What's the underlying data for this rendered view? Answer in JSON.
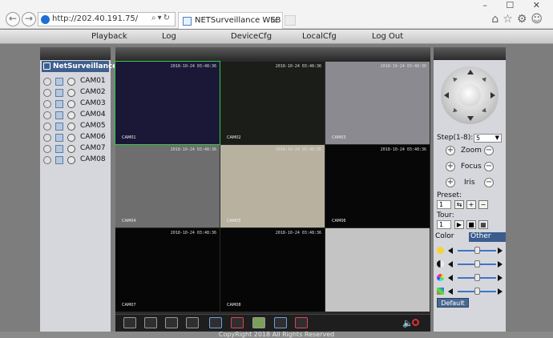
{
  "browser": {
    "url": "http://202.40.191.75/",
    "tab_title": "NETSurveillance WEB"
  },
  "menu": [
    "Playback",
    "Log",
    "DeviceCfg",
    "LocalCfg",
    "Log Out"
  ],
  "tree": {
    "title": "NetSurveillance",
    "cameras": [
      "CAM01",
      "CAM02",
      "CAM03",
      "CAM04",
      "CAM05",
      "CAM06",
      "CAM07",
      "CAM08"
    ]
  },
  "video": {
    "cells": [
      {
        "ts": "2018-10-24 03:48:36",
        "name": "CAM01",
        "bg": "#1a1836"
      },
      {
        "ts": "2018-10-24 03:48:36",
        "name": "CAM02",
        "bg": "#1b1d19"
      },
      {
        "ts": "2018-10-24 03:48:36",
        "name": "CAM03",
        "bg": "#8a8a90"
      },
      {
        "ts": "2018-10-24 03:48:36",
        "name": "CAM04",
        "bg": "#6e6e6e"
      },
      {
        "ts": "2018-10-24 03:48:36",
        "name": "CAM05",
        "bg": "#b9b1a0"
      },
      {
        "ts": "2018-10-24 03:48:36",
        "name": "CAM06",
        "bg": "#070707"
      },
      {
        "ts": "2018-10-24 03:48:36",
        "name": "CAM07",
        "bg": "#060606"
      },
      {
        "ts": "2018-10-24 03:48:36",
        "name": "CAM08",
        "bg": "#060606"
      },
      {
        "ts": "",
        "name": "",
        "bg": "#c4c4c4"
      }
    ]
  },
  "ptz": {
    "step_label": "Step(1-8):",
    "step_value": "5",
    "zoom": "Zoom",
    "focus": "Focus",
    "iris": "Iris",
    "preset_label": "Preset:",
    "preset_value": "1",
    "tour_label": "Tour:",
    "tour_value": "1"
  },
  "color_tabs": {
    "color": "Color",
    "other": "Other"
  },
  "default_button": "Default",
  "footer": "CopyRight 2018 All Rights Reserved",
  "colors": {
    "accent": "#3e5f8e",
    "selected_border": "#37c84a",
    "slider": "#3e74c9"
  }
}
